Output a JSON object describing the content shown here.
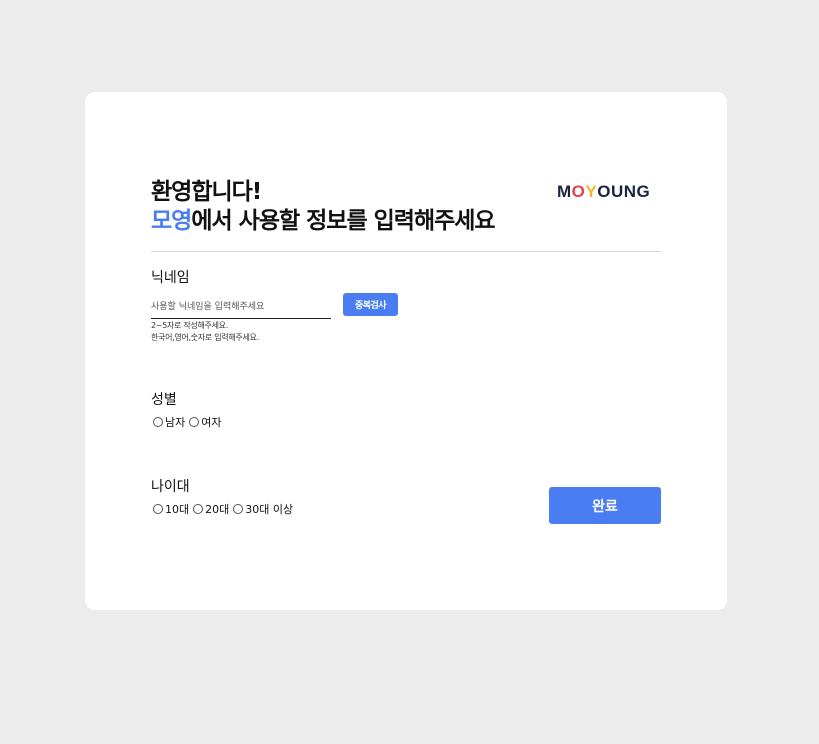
{
  "welcome": {
    "title_line1": "환영합니다!",
    "title_accent": "모영",
    "title_line2_rest": "에서 사용할 정보를 입력해주세요"
  },
  "logo": {
    "text_before": "M",
    "o_mark": "O",
    "y_mark": "Y",
    "text_after": "OUNG"
  },
  "nickname": {
    "label": "닉네임",
    "placeholder": "사용할 닉네임을 입력해주세요",
    "value": "",
    "duplicate_check_label": "중복검사",
    "hint_length": "2~5자로 작성해주세요.",
    "hint_chars": "한국어,영어,숫자로 입력해주세요."
  },
  "gender": {
    "label": "성별",
    "options": [
      "남자",
      "여자"
    ]
  },
  "age": {
    "label": "나이대",
    "options": [
      "10대",
      "20대",
      "30대 이상"
    ]
  },
  "submit": {
    "label": "완료"
  },
  "colors": {
    "accent": "#4a7cf2",
    "background": "#ececec",
    "card": "#ffffff"
  }
}
